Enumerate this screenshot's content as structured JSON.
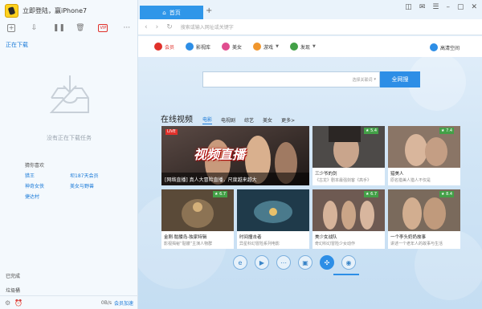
{
  "left": {
    "login_text": "立即登陆，赢iPhone7",
    "downloading": "正在下载",
    "empty_text": "没有正在下载任务",
    "recommend_title": "猜你喜欢",
    "recommend": [
      "猎王",
      "坝187天会员",
      "神奇女侠",
      "美女与野兽",
      "捷达村"
    ],
    "completed": "已完成",
    "trash": "垃圾桶",
    "speed": "0B/s",
    "accelerate": "会员加速"
  },
  "browser": {
    "tab_label": "首页",
    "address_placeholder": "搜索或输入网址或关键字",
    "nav": {
      "vip": "会员",
      "movies": "影视库",
      "beauty": "美女",
      "games": "游戏",
      "discover": "发现",
      "hd": "高清空间"
    },
    "search": {
      "placeholder": "",
      "engine": "选择关联词",
      "button": "全网搜"
    }
  },
  "videos": {
    "section_title": "在线视频",
    "categories": [
      "电影",
      "电视剧",
      "综艺",
      "美女",
      "更多>"
    ],
    "active_category": "电影",
    "live_badge": "LIVE",
    "big": {
      "overlay": "视频直播",
      "caption": "[网络直播] 真人大冒险直播，尺度越来越大"
    },
    "cards": [
      {
        "title": "三少爷的剑",
        "sub": "《古龙》剧本最强剑客《高手》",
        "rating": "5.4"
      },
      {
        "title": "猎美人",
        "sub": "原名猎美人猎人不仅是",
        "rating": "7.4"
      },
      {
        "title": "金刚·骷髅岛-独家特辑",
        "sub": "影视揭秘“骷髅”主演人物群",
        "rating": "6.7"
      },
      {
        "title": "时间撞击者",
        "sub": "异星科幻冒险系列电影",
        "rating": ""
      },
      {
        "title": "美少女战队",
        "sub": "奇幻科幻冒险少女动作",
        "rating": "6.7"
      },
      {
        "title": "一个李头奶奶故事",
        "sub": "讲述一个老年人的故事与生活",
        "rating": "8.4"
      }
    ]
  },
  "colors": {
    "accent": "#2d8ee6",
    "vip": "#e0312b",
    "badge": "#43a047"
  }
}
